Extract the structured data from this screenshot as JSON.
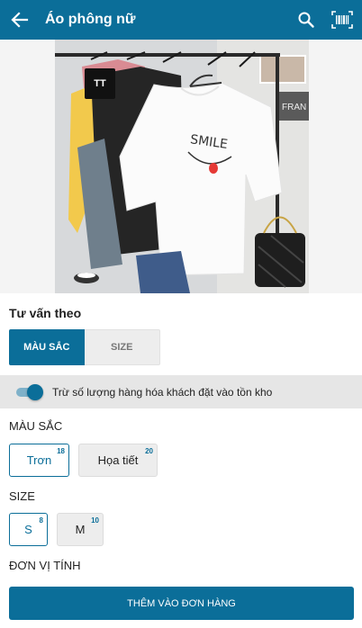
{
  "header": {
    "title": "Áo phông nữ",
    "back_icon": "arrow-left-icon",
    "search_icon": "search-icon",
    "barcode_icon": "barcode-scan-icon",
    "bg_color": "#0b6e99"
  },
  "product": {
    "image_alt": "white-tshirt-product-photo",
    "badge": "TT"
  },
  "advise": {
    "title": "Tư vấn theo",
    "options": [
      "MÀU SẮC",
      "SIZE"
    ],
    "selected": "MÀU SẮC"
  },
  "stock_toggle": {
    "label": "Trừ số lượng hàng hóa khách đặt vào tồn kho",
    "on": true
  },
  "color_section": {
    "label": "MÀU SẮC",
    "options": [
      {
        "label": "Trơn",
        "count": "18",
        "selected": true
      },
      {
        "label": "Họa tiết",
        "count": "20",
        "selected": false
      }
    ]
  },
  "size_section": {
    "label": "SIZE",
    "options": [
      {
        "label": "S",
        "count": "8",
        "selected": true
      },
      {
        "label": "M",
        "count": "10",
        "selected": false
      }
    ]
  },
  "unit_section": {
    "label": "ĐƠN VỊ TÍNH"
  },
  "add_button": {
    "label": "THÊM VÀO ĐƠN HÀNG"
  }
}
